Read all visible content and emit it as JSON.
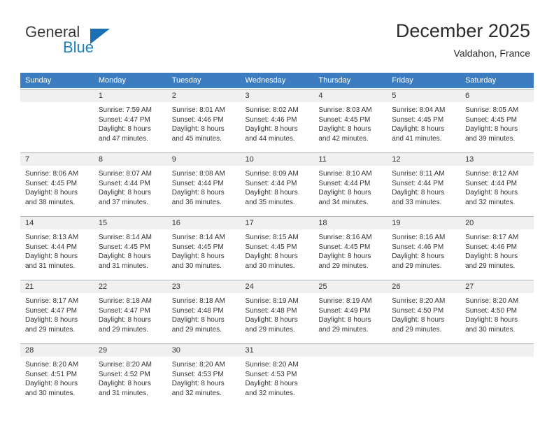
{
  "brand": {
    "name_top": "General",
    "name_bottom": "Blue",
    "triangle_color": "#1a6fb5",
    "blue_color": "#1a7fc1"
  },
  "header": {
    "title": "December 2025",
    "location": "Valdahon, France"
  },
  "calendar": {
    "header_bg": "#3b7dc0",
    "daynum_bg": "#f0f0f0",
    "weekday_labels": [
      "Sunday",
      "Monday",
      "Tuesday",
      "Wednesday",
      "Thursday",
      "Friday",
      "Saturday"
    ],
    "weeks": [
      [
        {
          "day": "",
          "sunrise": "",
          "sunset": "",
          "daylight_1": "",
          "daylight_2": ""
        },
        {
          "day": "1",
          "sunrise": "Sunrise: 7:59 AM",
          "sunset": "Sunset: 4:47 PM",
          "daylight_1": "Daylight: 8 hours",
          "daylight_2": "and 47 minutes."
        },
        {
          "day": "2",
          "sunrise": "Sunrise: 8:01 AM",
          "sunset": "Sunset: 4:46 PM",
          "daylight_1": "Daylight: 8 hours",
          "daylight_2": "and 45 minutes."
        },
        {
          "day": "3",
          "sunrise": "Sunrise: 8:02 AM",
          "sunset": "Sunset: 4:46 PM",
          "daylight_1": "Daylight: 8 hours",
          "daylight_2": "and 44 minutes."
        },
        {
          "day": "4",
          "sunrise": "Sunrise: 8:03 AM",
          "sunset": "Sunset: 4:45 PM",
          "daylight_1": "Daylight: 8 hours",
          "daylight_2": "and 42 minutes."
        },
        {
          "day": "5",
          "sunrise": "Sunrise: 8:04 AM",
          "sunset": "Sunset: 4:45 PM",
          "daylight_1": "Daylight: 8 hours",
          "daylight_2": "and 41 minutes."
        },
        {
          "day": "6",
          "sunrise": "Sunrise: 8:05 AM",
          "sunset": "Sunset: 4:45 PM",
          "daylight_1": "Daylight: 8 hours",
          "daylight_2": "and 39 minutes."
        }
      ],
      [
        {
          "day": "7",
          "sunrise": "Sunrise: 8:06 AM",
          "sunset": "Sunset: 4:45 PM",
          "daylight_1": "Daylight: 8 hours",
          "daylight_2": "and 38 minutes."
        },
        {
          "day": "8",
          "sunrise": "Sunrise: 8:07 AM",
          "sunset": "Sunset: 4:44 PM",
          "daylight_1": "Daylight: 8 hours",
          "daylight_2": "and 37 minutes."
        },
        {
          "day": "9",
          "sunrise": "Sunrise: 8:08 AM",
          "sunset": "Sunset: 4:44 PM",
          "daylight_1": "Daylight: 8 hours",
          "daylight_2": "and 36 minutes."
        },
        {
          "day": "10",
          "sunrise": "Sunrise: 8:09 AM",
          "sunset": "Sunset: 4:44 PM",
          "daylight_1": "Daylight: 8 hours",
          "daylight_2": "and 35 minutes."
        },
        {
          "day": "11",
          "sunrise": "Sunrise: 8:10 AM",
          "sunset": "Sunset: 4:44 PM",
          "daylight_1": "Daylight: 8 hours",
          "daylight_2": "and 34 minutes."
        },
        {
          "day": "12",
          "sunrise": "Sunrise: 8:11 AM",
          "sunset": "Sunset: 4:44 PM",
          "daylight_1": "Daylight: 8 hours",
          "daylight_2": "and 33 minutes."
        },
        {
          "day": "13",
          "sunrise": "Sunrise: 8:12 AM",
          "sunset": "Sunset: 4:44 PM",
          "daylight_1": "Daylight: 8 hours",
          "daylight_2": "and 32 minutes."
        }
      ],
      [
        {
          "day": "14",
          "sunrise": "Sunrise: 8:13 AM",
          "sunset": "Sunset: 4:44 PM",
          "daylight_1": "Daylight: 8 hours",
          "daylight_2": "and 31 minutes."
        },
        {
          "day": "15",
          "sunrise": "Sunrise: 8:14 AM",
          "sunset": "Sunset: 4:45 PM",
          "daylight_1": "Daylight: 8 hours",
          "daylight_2": "and 31 minutes."
        },
        {
          "day": "16",
          "sunrise": "Sunrise: 8:14 AM",
          "sunset": "Sunset: 4:45 PM",
          "daylight_1": "Daylight: 8 hours",
          "daylight_2": "and 30 minutes."
        },
        {
          "day": "17",
          "sunrise": "Sunrise: 8:15 AM",
          "sunset": "Sunset: 4:45 PM",
          "daylight_1": "Daylight: 8 hours",
          "daylight_2": "and 30 minutes."
        },
        {
          "day": "18",
          "sunrise": "Sunrise: 8:16 AM",
          "sunset": "Sunset: 4:45 PM",
          "daylight_1": "Daylight: 8 hours",
          "daylight_2": "and 29 minutes."
        },
        {
          "day": "19",
          "sunrise": "Sunrise: 8:16 AM",
          "sunset": "Sunset: 4:46 PM",
          "daylight_1": "Daylight: 8 hours",
          "daylight_2": "and 29 minutes."
        },
        {
          "day": "20",
          "sunrise": "Sunrise: 8:17 AM",
          "sunset": "Sunset: 4:46 PM",
          "daylight_1": "Daylight: 8 hours",
          "daylight_2": "and 29 minutes."
        }
      ],
      [
        {
          "day": "21",
          "sunrise": "Sunrise: 8:17 AM",
          "sunset": "Sunset: 4:47 PM",
          "daylight_1": "Daylight: 8 hours",
          "daylight_2": "and 29 minutes."
        },
        {
          "day": "22",
          "sunrise": "Sunrise: 8:18 AM",
          "sunset": "Sunset: 4:47 PM",
          "daylight_1": "Daylight: 8 hours",
          "daylight_2": "and 29 minutes."
        },
        {
          "day": "23",
          "sunrise": "Sunrise: 8:18 AM",
          "sunset": "Sunset: 4:48 PM",
          "daylight_1": "Daylight: 8 hours",
          "daylight_2": "and 29 minutes."
        },
        {
          "day": "24",
          "sunrise": "Sunrise: 8:19 AM",
          "sunset": "Sunset: 4:48 PM",
          "daylight_1": "Daylight: 8 hours",
          "daylight_2": "and 29 minutes."
        },
        {
          "day": "25",
          "sunrise": "Sunrise: 8:19 AM",
          "sunset": "Sunset: 4:49 PM",
          "daylight_1": "Daylight: 8 hours",
          "daylight_2": "and 29 minutes."
        },
        {
          "day": "26",
          "sunrise": "Sunrise: 8:20 AM",
          "sunset": "Sunset: 4:50 PM",
          "daylight_1": "Daylight: 8 hours",
          "daylight_2": "and 29 minutes."
        },
        {
          "day": "27",
          "sunrise": "Sunrise: 8:20 AM",
          "sunset": "Sunset: 4:50 PM",
          "daylight_1": "Daylight: 8 hours",
          "daylight_2": "and 30 minutes."
        }
      ],
      [
        {
          "day": "28",
          "sunrise": "Sunrise: 8:20 AM",
          "sunset": "Sunset: 4:51 PM",
          "daylight_1": "Daylight: 8 hours",
          "daylight_2": "and 30 minutes."
        },
        {
          "day": "29",
          "sunrise": "Sunrise: 8:20 AM",
          "sunset": "Sunset: 4:52 PM",
          "daylight_1": "Daylight: 8 hours",
          "daylight_2": "and 31 minutes."
        },
        {
          "day": "30",
          "sunrise": "Sunrise: 8:20 AM",
          "sunset": "Sunset: 4:53 PM",
          "daylight_1": "Daylight: 8 hours",
          "daylight_2": "and 32 minutes."
        },
        {
          "day": "31",
          "sunrise": "Sunrise: 8:20 AM",
          "sunset": "Sunset: 4:53 PM",
          "daylight_1": "Daylight: 8 hours",
          "daylight_2": "and 32 minutes."
        },
        {
          "day": "",
          "sunrise": "",
          "sunset": "",
          "daylight_1": "",
          "daylight_2": ""
        },
        {
          "day": "",
          "sunrise": "",
          "sunset": "",
          "daylight_1": "",
          "daylight_2": ""
        },
        {
          "day": "",
          "sunrise": "",
          "sunset": "",
          "daylight_1": "",
          "daylight_2": ""
        }
      ]
    ]
  }
}
